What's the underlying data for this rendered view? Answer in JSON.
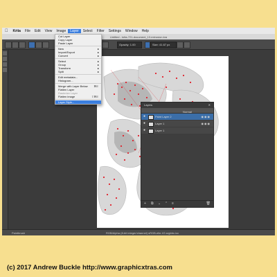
{
  "menubar": {
    "app_name": "Krita",
    "items": [
      "File",
      "Edit",
      "View",
      "Image",
      "Layer",
      "Select",
      "Filter",
      "Settings",
      "Window",
      "Help"
    ],
    "active_index": 4
  },
  "window": {
    "title": "Untitled - krita-721-document_13.extrusion.kra"
  },
  "toolbar": {
    "opacity_label": "Opacity: 1.00",
    "size_label": "Size: 41.67 px"
  },
  "layer_menu": {
    "items": [
      {
        "label": "Cut Layer",
        "arrow": false,
        "shortcut": "",
        "disabled": false
      },
      {
        "label": "Copy Layer",
        "arrow": false,
        "shortcut": "",
        "disabled": false
      },
      {
        "label": "Paste Layer",
        "arrow": false,
        "shortcut": "",
        "disabled": false
      },
      {
        "sep": true
      },
      {
        "label": "New",
        "arrow": true,
        "shortcut": "",
        "disabled": false
      },
      {
        "label": "Import/Export",
        "arrow": true,
        "shortcut": "",
        "disabled": false
      },
      {
        "label": "Convert",
        "arrow": true,
        "shortcut": "",
        "disabled": false
      },
      {
        "sep": true
      },
      {
        "label": "Select",
        "arrow": true,
        "shortcut": "",
        "disabled": false
      },
      {
        "label": "Group",
        "arrow": true,
        "shortcut": "",
        "disabled": false
      },
      {
        "label": "Transform",
        "arrow": true,
        "shortcut": "",
        "disabled": false
      },
      {
        "label": "Split",
        "arrow": true,
        "shortcut": "",
        "disabled": false
      },
      {
        "sep": true
      },
      {
        "label": "Edit metadata...",
        "arrow": false,
        "shortcut": "",
        "disabled": false
      },
      {
        "label": "Histogram...",
        "arrow": false,
        "shortcut": "",
        "disabled": false
      },
      {
        "sep": true
      },
      {
        "label": "Merge with Layer Below",
        "arrow": false,
        "shortcut": "⌘E",
        "disabled": false
      },
      {
        "label": "Flatten Layer",
        "arrow": false,
        "shortcut": "",
        "disabled": false
      },
      {
        "label": "Rasterize Layer",
        "arrow": false,
        "shortcut": "",
        "disabled": true
      },
      {
        "label": "Flatten image",
        "arrow": false,
        "shortcut": "⇧⌘E",
        "disabled": false
      },
      {
        "sep": true
      },
      {
        "label": "Layer Style...",
        "arrow": false,
        "shortcut": "",
        "disabled": false,
        "selected": true
      }
    ]
  },
  "layers_panel": {
    "title": "Layers",
    "blend_mode": "Normal",
    "layers": [
      {
        "name": "Paint Layer 2",
        "selected": true
      },
      {
        "name": "Layer 1",
        "selected": false
      },
      {
        "name": "Layer 1",
        "selected": false
      }
    ]
  },
  "statusbar": {
    "left_text": "Paintbrush",
    "center_text": "RGB/Alpha (8-bit integer/channel)  sRGB-elle-V2-srgbtrc.icc"
  },
  "copyright": "(c) 2017 Andrew Buckle http://www.graphicxtras.com",
  "colors": {
    "background": "#f7df8f",
    "accent": "#3b7fe0",
    "dots": "#e0202a"
  }
}
